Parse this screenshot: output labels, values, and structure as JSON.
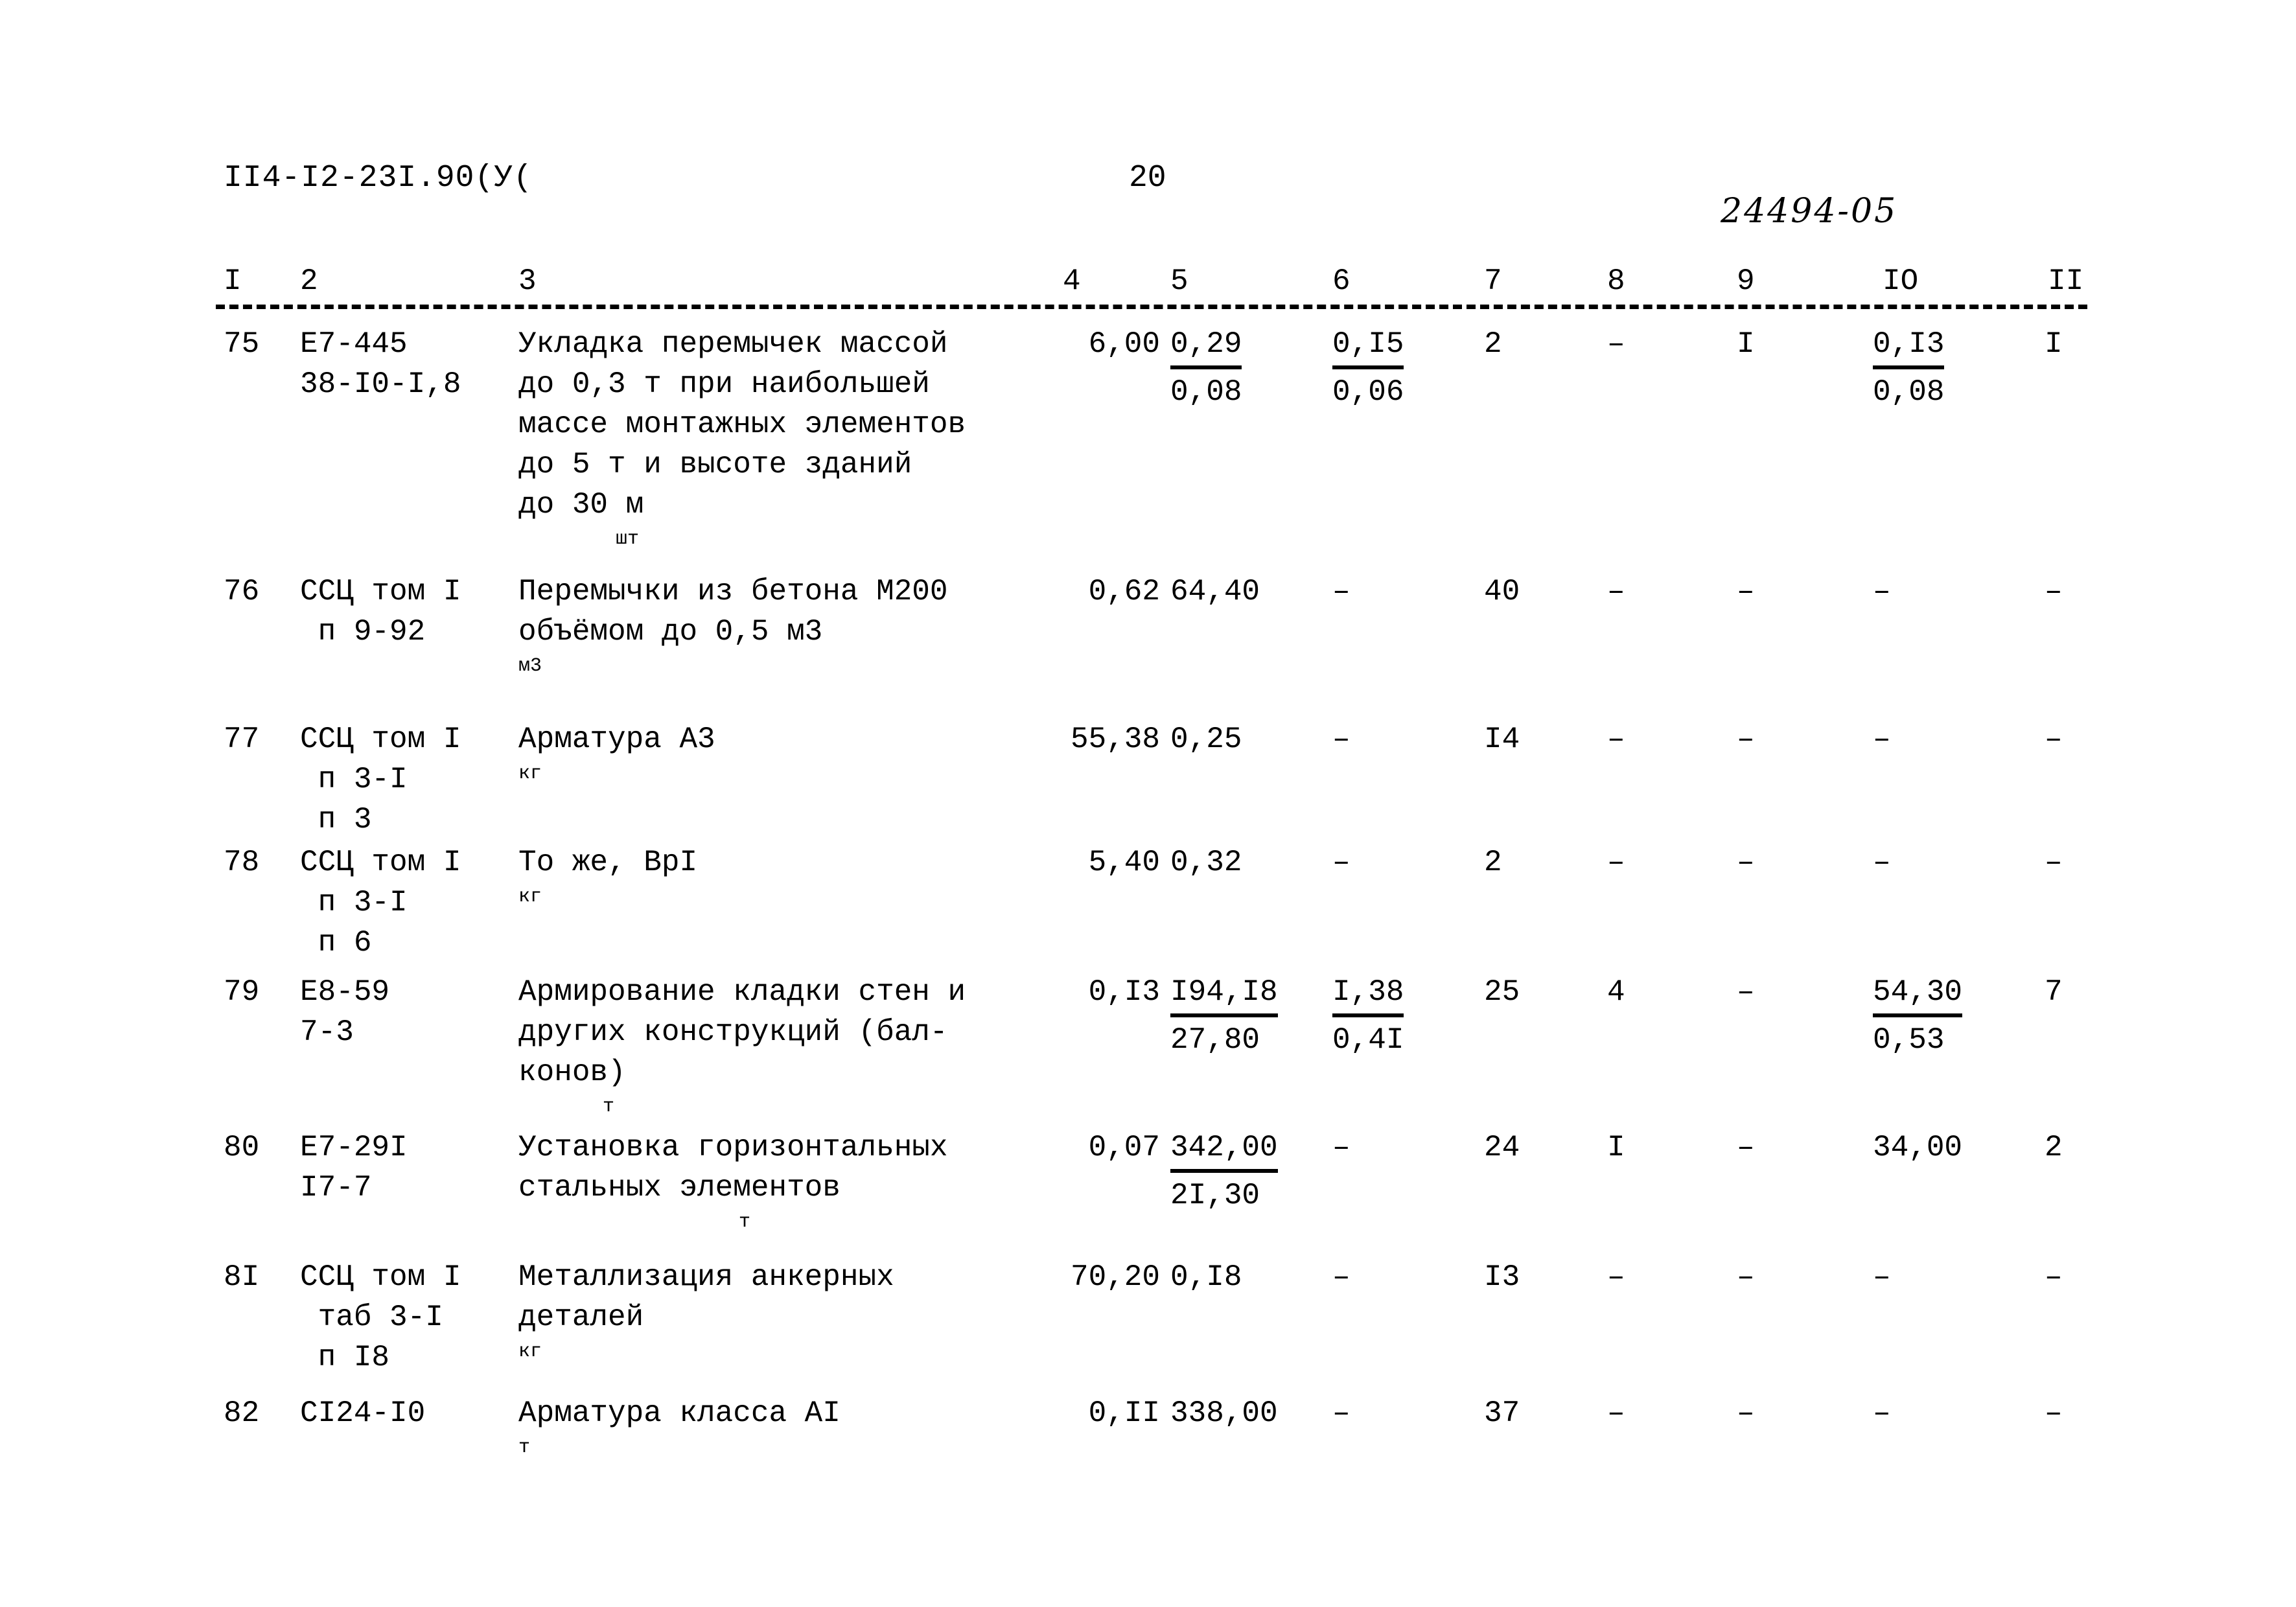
{
  "header": {
    "doc_code": "II4-I2-23I.90(У(",
    "page_number": "20",
    "archive_code": "24494-05"
  },
  "table": {
    "column_headers": [
      "I",
      "2",
      "3",
      "4",
      "5",
      "6",
      "7",
      "8",
      "9",
      "IO",
      "II"
    ],
    "rows": [
      {
        "num": "75",
        "code": "Е7-445\n38-I0-I,8",
        "desc": "Укладка перемычек массой\nдо 0,3 т при наибольшей\nмассе монтажных элементов\nдо 5 т и высоте зданий\nдо 30 м",
        "unit": "шт",
        "c4": "6,00",
        "c5_top": "0,29",
        "c5_bot": "0,08",
        "c6_top": "0,I5",
        "c6_bot": "0,06",
        "c7": "2",
        "c8": "–",
        "c9": "I",
        "c10_top": "0,I3",
        "c10_bot": "0,08",
        "c11": "I"
      },
      {
        "num": "76",
        "code": "ССЦ том I\n п 9-92",
        "desc": "Перемычки из бетона М200\nобъёмом до 0,5 м3",
        "unit": "м3",
        "c4": "0,62",
        "c5": "64,40",
        "c6": "–",
        "c7": "40",
        "c8": "–",
        "c9": "–",
        "c10": "–",
        "c11": "–"
      },
      {
        "num": "77",
        "code": "ССЦ том I\n п 3-I\n п 3",
        "desc": "Арматура А3",
        "unit": "кг",
        "c4": "55,38",
        "c5": "0,25",
        "c6": "–",
        "c7": "I4",
        "c8": "–",
        "c9": "–",
        "c10": "–",
        "c11": "–"
      },
      {
        "num": "78",
        "code": "ССЦ том I\n п 3-I\n п 6",
        "desc": "То же, ВрI",
        "unit": "кг",
        "c4": "5,40",
        "c5": "0,32",
        "c6": "–",
        "c7": "2",
        "c8": "–",
        "c9": "–",
        "c10": "–",
        "c11": "–"
      },
      {
        "num": "79",
        "code": "Е8-59\n7-3",
        "desc": "Армирование кладки стен и\nдругих конструкций (бал-\nконов)",
        "unit": "т",
        "c4": "0,I3",
        "c5_top": "I94,I8",
        "c5_bot": "27,80",
        "c6_top": "I,38",
        "c6_bot": "0,4I",
        "c7": "25",
        "c8": "4",
        "c9": "–",
        "c10_top": "54,30",
        "c10_bot": "0,53",
        "c11": "7"
      },
      {
        "num": "80",
        "code": "Е7-29I\nI7-7",
        "desc": "Установка горизонтальных\nстальных элементов",
        "unit": "т",
        "c4": "0,07",
        "c5_top": "342,00",
        "c5_bot": "2I,30",
        "c6": "–",
        "c7": "24",
        "c8": "I",
        "c9": "–",
        "c10": "34,00",
        "c11": "2"
      },
      {
        "num": "8I",
        "code": "ССЦ том I\n таб 3-I\n п I8",
        "desc": "Металлизация анкерных\nдеталей",
        "unit": "кг",
        "c4": "70,20",
        "c5": "0,I8",
        "c6": "–",
        "c7": "I3",
        "c8": "–",
        "c9": "–",
        "c10": "–",
        "c11": "–"
      },
      {
        "num": "82",
        "code": "СI24-I0",
        "desc": "Арматура класса АI",
        "unit": "т",
        "c4": "0,II",
        "c5": "338,00",
        "c6": "–",
        "c7": "37",
        "c8": "–",
        "c9": "–",
        "c10": "–",
        "c11": "–"
      }
    ]
  }
}
